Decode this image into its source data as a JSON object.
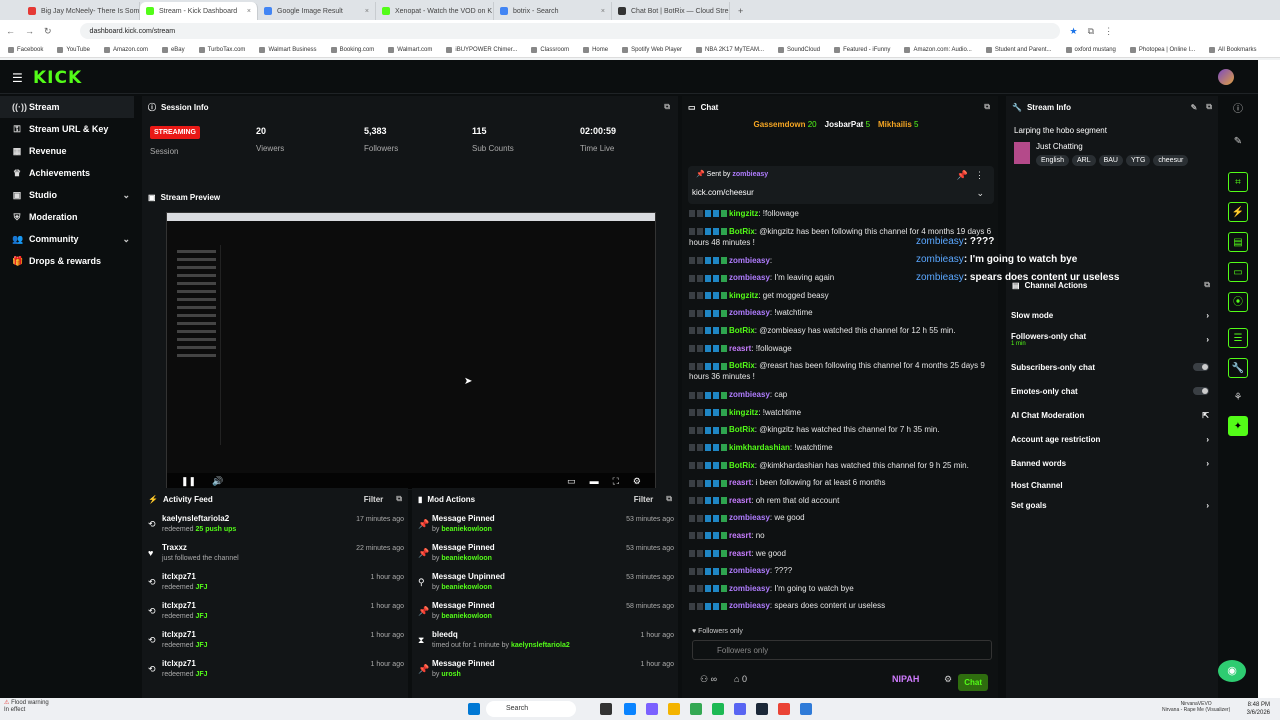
{
  "browser": {
    "tabs": [
      {
        "label": "Big Jay McNeely- There Is Somo",
        "color": "#e53935",
        "active": false
      },
      {
        "label": "Stream - Kick Dashboard",
        "color": "#53fc18",
        "active": true
      },
      {
        "label": "Google Image Result",
        "color": "#4285f4",
        "active": false
      },
      {
        "label": "Xenopat - Watch the VOD on K",
        "color": "#53fc18",
        "active": false
      },
      {
        "label": "botrix - Search",
        "color": "#4285f4",
        "active": false
      },
      {
        "label": "Chat Bot | BotRix — Cloud Stre",
        "color": "#333333",
        "active": false
      }
    ],
    "url": "dashboard.kick.com/stream",
    "bookmarks": [
      "Facebook",
      "YouTube",
      "Amazon.com",
      "eBay",
      "TurboTax.com",
      "Walmart Business",
      "Booking.com",
      "Walmart.com",
      "iBUYPOWER Chimer...",
      "Classroom",
      "Home",
      "Spotify Web Player",
      "NBA 2K17 MyTEAM...",
      "SoundCloud",
      "Featured - iFunny",
      "Amazon.com: Audio...",
      "Student and Parent...",
      "oxford mustang",
      "Photopea | Online I...",
      "All Bookmarks"
    ]
  },
  "sidebar": {
    "items": [
      {
        "label": "Stream",
        "icon": "stream-icon",
        "glyph": "((·))"
      },
      {
        "label": "Stream URL & Key",
        "icon": "key-icon",
        "glyph": "⚿"
      },
      {
        "label": "Revenue",
        "icon": "revenue-icon",
        "glyph": "▦"
      },
      {
        "label": "Achievements",
        "icon": "trophy-icon",
        "glyph": "♛"
      },
      {
        "label": "Studio",
        "icon": "studio-icon",
        "glyph": "▣"
      },
      {
        "label": "Moderation",
        "icon": "shield-icon",
        "glyph": "⛨"
      },
      {
        "label": "Community",
        "icon": "community-icon",
        "glyph": "👥"
      },
      {
        "label": "Drops & rewards",
        "icon": "gift-icon",
        "glyph": "🎁"
      }
    ]
  },
  "session": {
    "title": "Session Info",
    "badge": "STREAMING",
    "badge_label": "Session",
    "viewers": "20",
    "viewers_label": "Viewers",
    "followers": "5,383",
    "followers_label": "Followers",
    "subs": "115",
    "subs_label": "Sub Counts",
    "time": "02:00:59",
    "time_label": "Time Live"
  },
  "preview": {
    "title": "Stream Preview"
  },
  "activity": {
    "title": "Activity Feed",
    "filter": "Filter",
    "rows": [
      {
        "user": "kaelynsleftariola2",
        "pre": "redeemed",
        "hl": "25 push ups",
        "time": "17 minutes ago",
        "icon": "redeem-icon",
        "glyph": "⟲"
      },
      {
        "user": "Traxxz",
        "pre": "just followed the channel",
        "hl": "",
        "time": "22 minutes ago",
        "icon": "heart-icon",
        "glyph": "♥"
      },
      {
        "user": "itclxpz71",
        "pre": "redeemed",
        "hl": "JFJ",
        "time": "1 hour ago",
        "icon": "redeem-icon",
        "glyph": "⟲"
      },
      {
        "user": "itclxpz71",
        "pre": "redeemed",
        "hl": "JFJ",
        "time": "1 hour ago",
        "icon": "redeem-icon",
        "glyph": "⟲"
      },
      {
        "user": "itclxpz71",
        "pre": "redeemed",
        "hl": "JFJ",
        "time": "1 hour ago",
        "icon": "redeem-icon",
        "glyph": "⟲"
      },
      {
        "user": "itclxpz71",
        "pre": "redeemed",
        "hl": "JFJ",
        "time": "1 hour ago",
        "icon": "redeem-icon",
        "glyph": "⟲"
      }
    ]
  },
  "modactions": {
    "title": "Mod Actions",
    "filter": "Filter",
    "rows": [
      {
        "user": "Message Pinned",
        "pre": "by",
        "hl": "beaniekowloon",
        "time": "53 minutes ago",
        "icon": "pin-icon",
        "glyph": "📌"
      },
      {
        "user": "Message Pinned",
        "pre": "by",
        "hl": "beaniekowloon",
        "time": "53 minutes ago",
        "icon": "pin-icon",
        "glyph": "📌"
      },
      {
        "user": "Message Unpinned",
        "pre": "by",
        "hl": "beaniekowloon",
        "time": "53 minutes ago",
        "icon": "unpin-icon",
        "glyph": "⚲"
      },
      {
        "user": "Message Pinned",
        "pre": "by",
        "hl": "beaniekowloon",
        "time": "58 minutes ago",
        "icon": "pin-icon",
        "glyph": "📌"
      },
      {
        "user": "bleedq",
        "pre": "timed out for 1 minute by",
        "hl": "kaelynsleftariola2",
        "time": "1 hour ago",
        "icon": "hourglass-icon",
        "glyph": "⧗"
      },
      {
        "user": "Message Pinned",
        "pre": "by",
        "hl": "urosh",
        "time": "1 hour ago",
        "icon": "pin-icon",
        "glyph": "📌"
      }
    ]
  },
  "chat": {
    "title": "Chat",
    "gifters": [
      {
        "name": "Gassemdown",
        "count": "20"
      },
      {
        "name": "JosbarPat",
        "count": "5"
      },
      {
        "name": "Mikhailis",
        "count": "5"
      }
    ],
    "pinned_by": "Sent by",
    "pinned_user": "zombieasy",
    "pinned_text": "kick.com/cheesur",
    "messages": [
      {
        "user": "kingzitz",
        "text": "!followage",
        "color": "#53fc18"
      },
      {
        "user": "BotRix",
        "text": "@kingzitz has been following this channel for 4 months 19 days 6 hours 48 minutes !",
        "color": "#53fc18"
      },
      {
        "user": "zombieasy",
        "text": "",
        "color": "#b07dff"
      },
      {
        "user": "zombieasy",
        "text": "I'm leaving again",
        "color": "#b07dff"
      },
      {
        "user": "kingzitz",
        "text": "get mogged beasy",
        "color": "#53fc18"
      },
      {
        "user": "zombieasy",
        "text": "!watchtime",
        "color": "#b07dff"
      },
      {
        "user": "BotRix",
        "text": "@zombieasy has watched this channel for 12 h 55 min.",
        "color": "#53fc18"
      },
      {
        "user": "reasrt",
        "text": "!followage",
        "color": "#c77dff"
      },
      {
        "user": "BotRix",
        "text": "@reasrt has been following this channel for 4 months 25 days 9 hours 36 minutes !",
        "color": "#53fc18"
      },
      {
        "user": "zombieasy",
        "text": "cap",
        "color": "#b07dff"
      },
      {
        "user": "kingzitz",
        "text": "!watchtime",
        "color": "#53fc18"
      },
      {
        "user": "BotRix",
        "text": "@kingzitz has watched this channel for 7 h 35 min.",
        "color": "#53fc18"
      },
      {
        "user": "kimkhardashian",
        "text": "!watchtime",
        "color": "#53fc18"
      },
      {
        "user": "BotRix",
        "text": "@kimkhardashian has watched this channel for 9 h 25 min.",
        "color": "#53fc18"
      },
      {
        "user": "reasrt",
        "text": "i been following for at least 6 months",
        "color": "#c77dff"
      },
      {
        "user": "reasrt",
        "text": "oh rem that old account",
        "color": "#c77dff"
      },
      {
        "user": "zombieasy",
        "text": "we good",
        "color": "#b07dff"
      },
      {
        "user": "reasrt",
        "text": "no",
        "color": "#c77dff"
      },
      {
        "user": "reasrt",
        "text": "we good",
        "color": "#c77dff"
      },
      {
        "user": "zombieasy",
        "text": "????",
        "color": "#b07dff"
      },
      {
        "user": "zombieasy",
        "text": "I'm going to watch bye",
        "color": "#b07dff"
      },
      {
        "user": "zombieasy",
        "text": "spears does content ur useless",
        "color": "#b07dff"
      }
    ],
    "followers_mode": "Followers only",
    "input_placeholder": "Followers only",
    "count": "0",
    "brand": "NIPAH",
    "send": "Chat"
  },
  "overlay": [
    {
      "user": "zombieasy",
      "text": "????"
    },
    {
      "user": "zombieasy",
      "text": "I'm going to watch bye"
    },
    {
      "user": "zombieasy",
      "text": "spears does content ur useless"
    }
  ],
  "streaminfo": {
    "title": "Stream Info",
    "stream_title": "Larping the hobo segment",
    "category": "Just Chatting",
    "tags": [
      "English",
      "ARL",
      "BAU",
      "YTG",
      "cheesur"
    ]
  },
  "channel_actions": {
    "title": "Channel Actions",
    "rows": [
      {
        "label": "Slow mode",
        "sub": "",
        "kind": "chev"
      },
      {
        "label": "Followers-only chat",
        "sub": "1 min",
        "kind": "chev"
      },
      {
        "label": "Subscribers-only chat",
        "sub": "",
        "kind": "toggle"
      },
      {
        "label": "Emotes-only chat",
        "sub": "",
        "kind": "toggle"
      },
      {
        "label": "AI Chat Moderation",
        "sub": "",
        "kind": "ext"
      },
      {
        "label": "Account age restriction",
        "sub": "",
        "kind": "chev"
      },
      {
        "label": "Banned words",
        "sub": "",
        "kind": "chev"
      },
      {
        "label": "Host Channel",
        "sub": "",
        "kind": "none"
      },
      {
        "label": "Set goals",
        "sub": "",
        "kind": "chev"
      }
    ]
  },
  "taskbar": {
    "search": "Search",
    "warning_title": "Flood warning",
    "warning_sub": "In effect",
    "time": "8:48 PM",
    "date": "3/6/2026",
    "now_playing_artist": "NirvanaVEVO",
    "now_playing_song": "Nirvana - Rape Me (Visualizer)"
  }
}
